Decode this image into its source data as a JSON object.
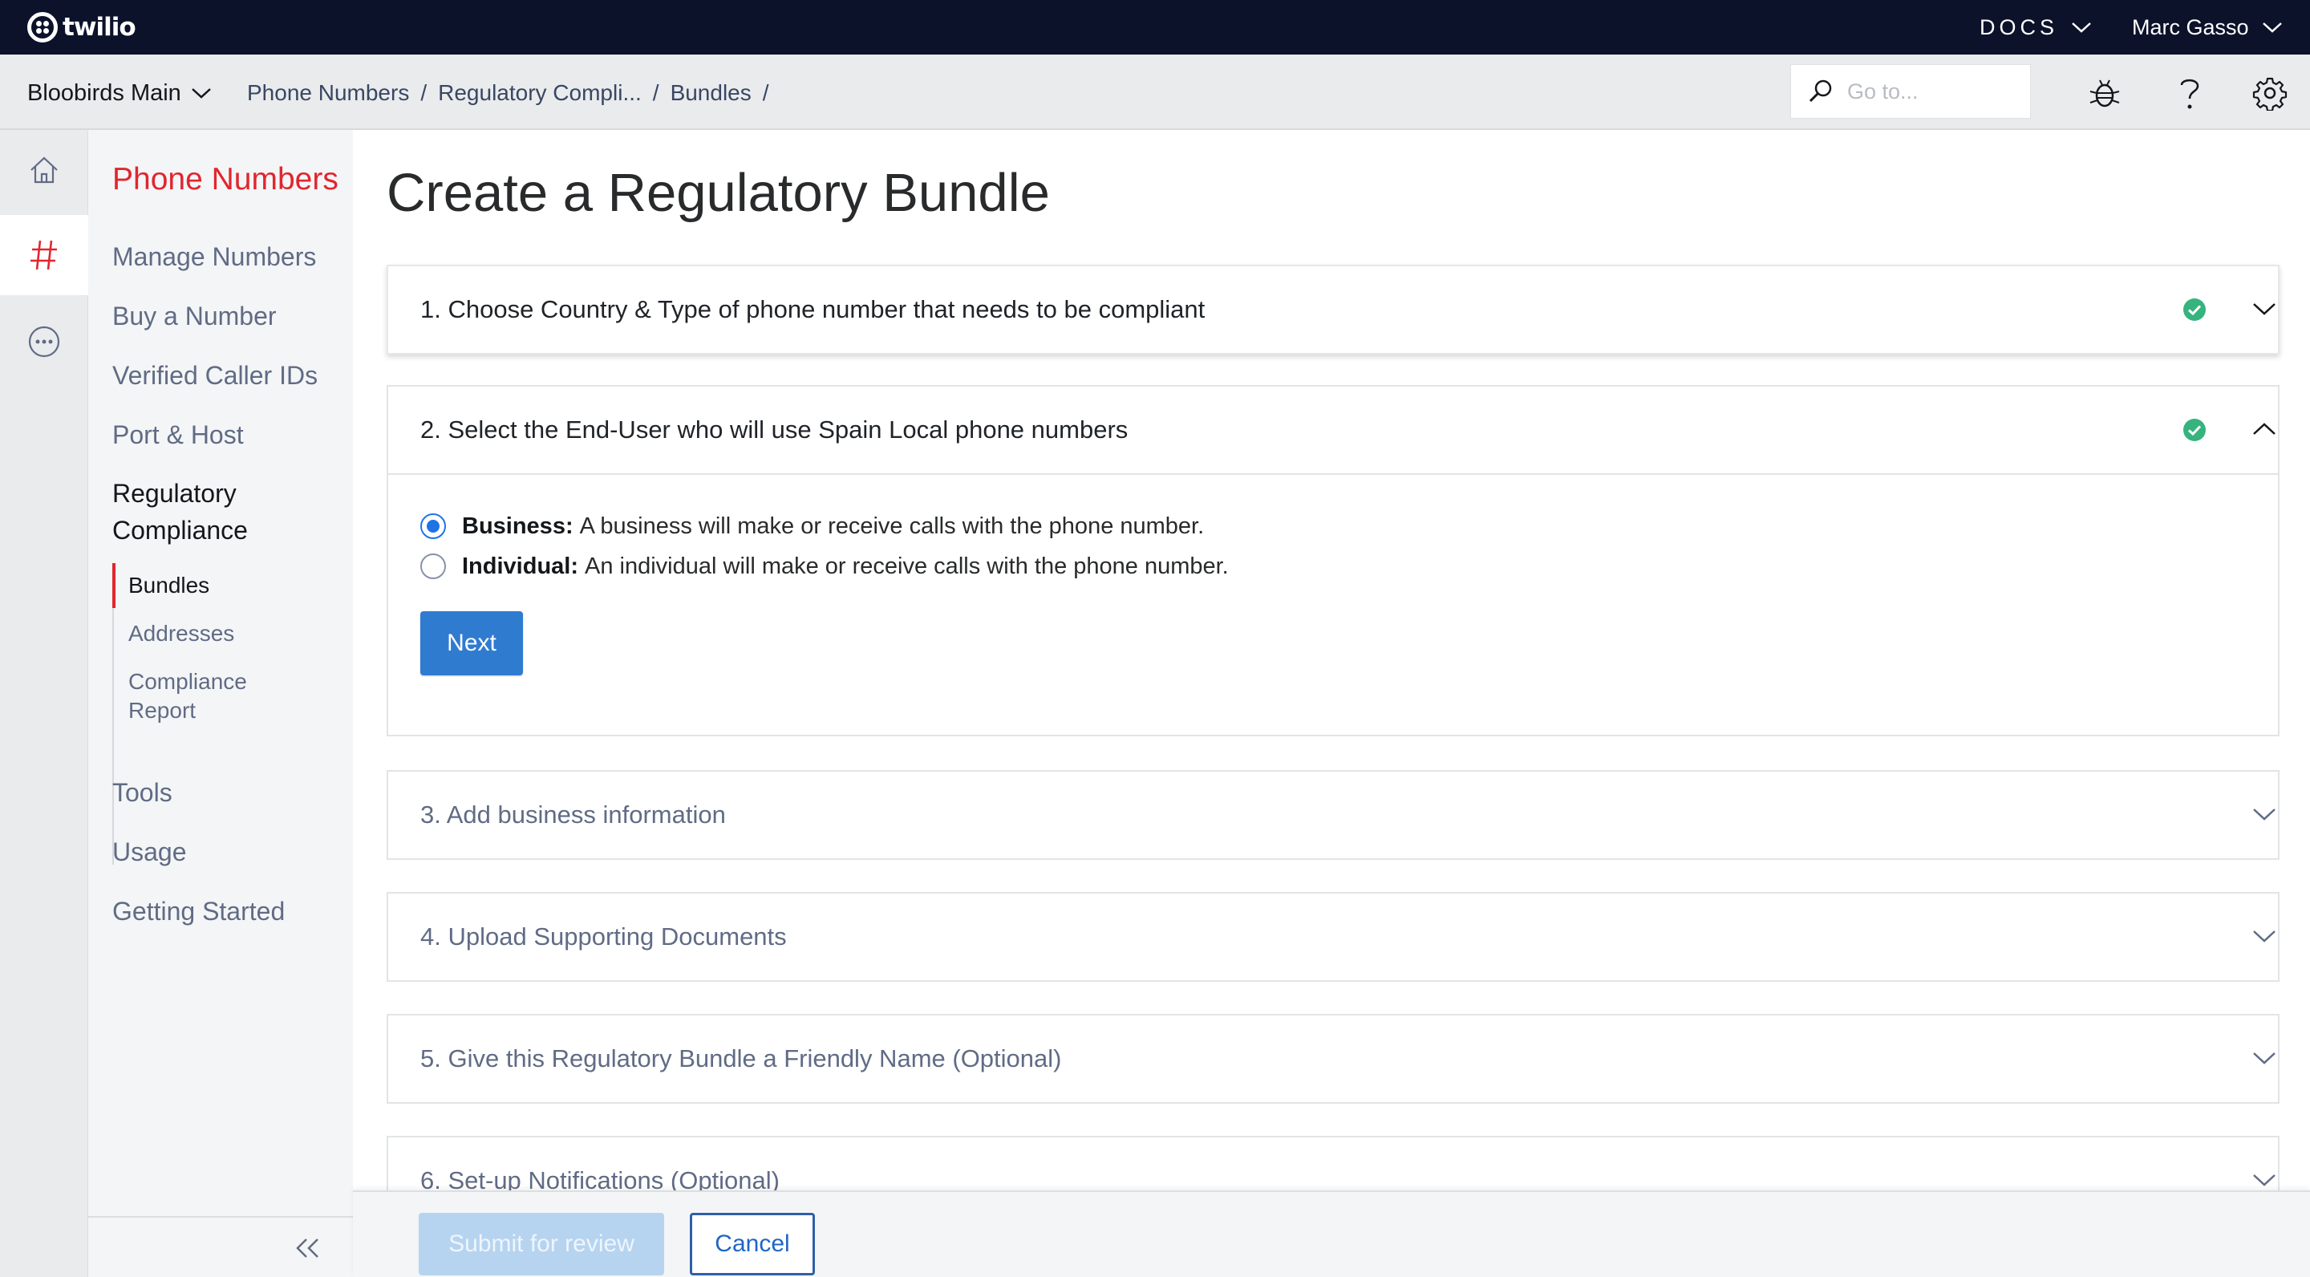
{
  "app": {
    "brand": "twilio",
    "docs_label": "DOCS",
    "user_name": "Marc Gasso"
  },
  "subheader": {
    "account": "Bloobirds Main",
    "breadcrumbs": [
      "Phone Numbers",
      "Regulatory Compli...",
      "Bundles"
    ],
    "search_placeholder": "Go to..."
  },
  "sidenav": {
    "section_title": "Phone Numbers",
    "items": [
      "Manage Numbers",
      "Buy a Number",
      "Verified Caller IDs",
      "Port & Host"
    ],
    "regulatory": [
      "Regulatory",
      "Compliance"
    ],
    "subitems": [
      "Bundles",
      "Addresses",
      "Compliance",
      "Report"
    ],
    "bottom_items": [
      "Tools",
      "Usage",
      "Getting Started"
    ]
  },
  "page": {
    "title": "Create a Regulatory Bundle",
    "steps": [
      {
        "title": "1. Choose Country & Type of phone number that needs to be compliant"
      },
      {
        "title": "2. Select the End-User who will use Spain Local phone numbers"
      },
      {
        "title": "3. Add business information"
      },
      {
        "title": "4. Upload Supporting Documents"
      },
      {
        "title": "5. Give this Regulatory Bundle a Friendly Name (Optional)"
      },
      {
        "title": "6. Set-up Notifications (Optional)"
      }
    ],
    "options": [
      {
        "label": "Business:",
        "description": "A business will make or receive calls with the phone number."
      },
      {
        "label": "Individual:",
        "description": "An individual will make or receive calls with the phone number."
      }
    ],
    "next_label": "Next"
  },
  "footer": {
    "submit_label": "Submit for review",
    "cancel_label": "Cancel"
  },
  "colors": {
    "topbar": "#0d122b",
    "accent_red": "#e0262f",
    "primary_blue": "#2f7bd0",
    "success_green": "#36b37e"
  }
}
